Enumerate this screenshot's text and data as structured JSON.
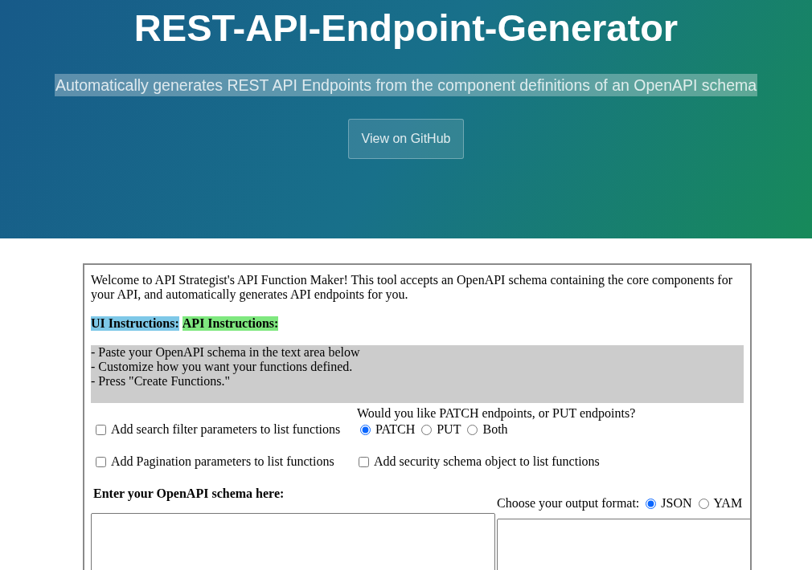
{
  "header": {
    "title": "REST-API-Endpoint-Generator",
    "subtitle": "Automatically generates REST API Endpoints from the component definitions of an OpenAPI schema",
    "button": "View on GitHub"
  },
  "tool": {
    "intro": "Welcome to API Strategist's API Function Maker! This tool accepts an OpenAPI schema containing the core components for your API, and automatically generates API endpoints for you.",
    "instruction_tabs": [
      {
        "label": "UI Instructions:",
        "color": "#7ec8e8"
      },
      {
        "label": "API Instructions:",
        "color": "#7fe87f"
      }
    ],
    "instructions": [
      "- Paste your OpenAPI schema in the text area below",
      "- Customize how you want your functions defined.",
      "- Press \"Create Functions.\""
    ],
    "options": [
      {
        "label": "Add search filter parameters to list functions",
        "checked": false
      },
      {
        "label": "Add Pagination parameters to list functions",
        "checked": false
      }
    ],
    "method_question": "Would you like PATCH endpoints, or PUT endpoints?",
    "methods": [
      {
        "label": "PATCH",
        "selected": true
      },
      {
        "label": "PUT",
        "selected": false
      },
      {
        "label": "Both",
        "selected": false
      }
    ],
    "security_option": {
      "label": "Add security schema object to list functions",
      "checked": false
    },
    "schema_label": "Enter your OpenAPI schema here:",
    "format_label": "Choose your output format:",
    "formats": [
      {
        "label": "JSON",
        "selected": true
      },
      {
        "label": "YAM",
        "selected": false
      }
    ]
  }
}
